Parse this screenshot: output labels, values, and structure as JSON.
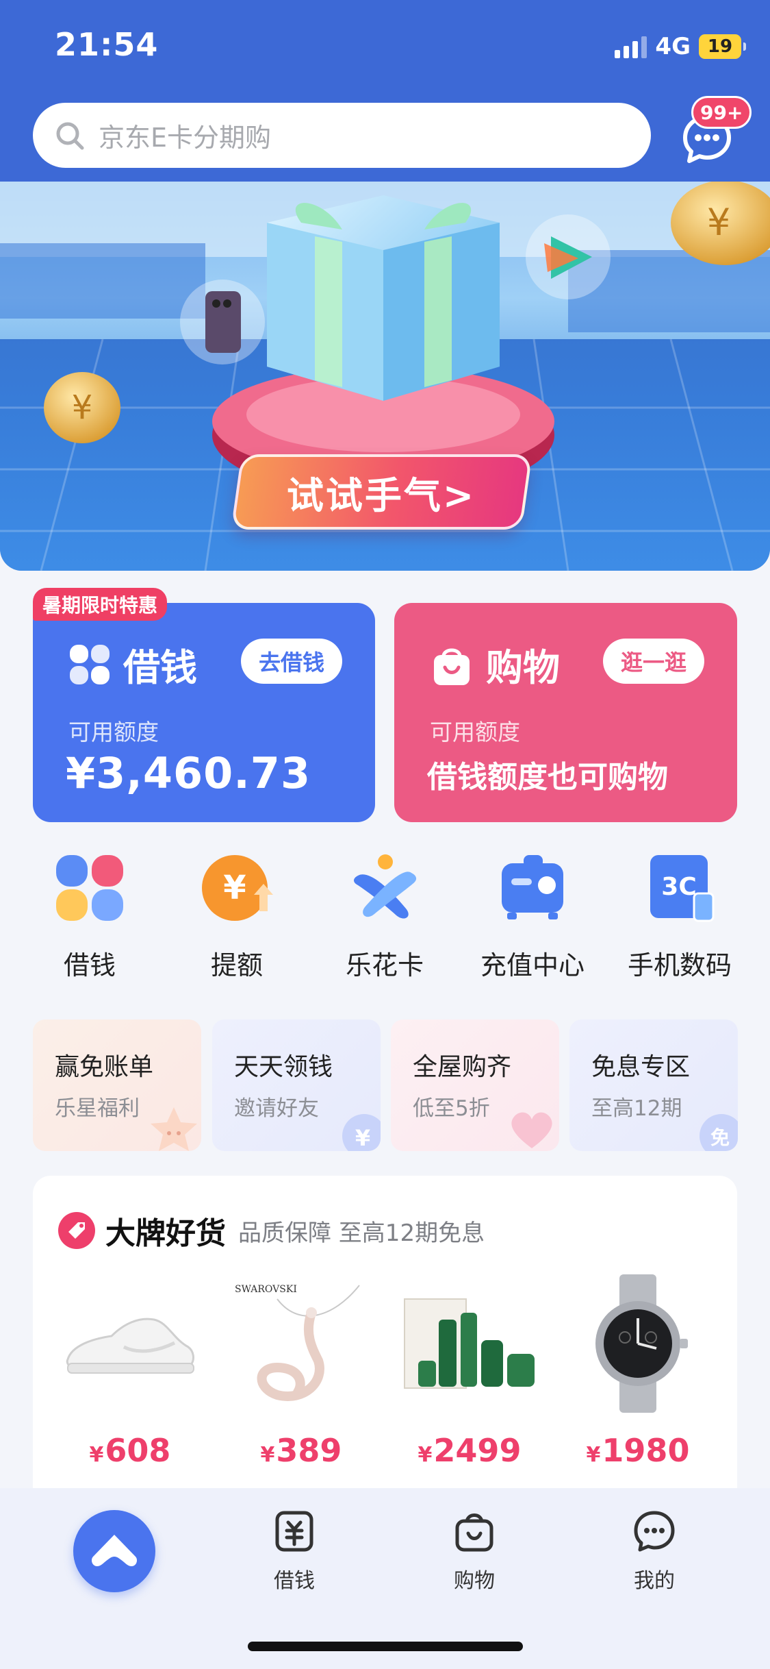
{
  "status_bar": {
    "time": "21:54",
    "network": "4G",
    "battery": "19"
  },
  "search": {
    "placeholder": "京东E卡分期购"
  },
  "messages": {
    "badge": "99+"
  },
  "banner": {
    "cta": "试试手气>"
  },
  "loan_card": {
    "promo_tag": "暑期限时特惠",
    "title": "借钱",
    "button": "去借钱",
    "sub": "可用额度",
    "amount": "¥3,460.73"
  },
  "shop_card": {
    "title": "购物",
    "button": "逛一逛",
    "sub": "可用额度",
    "desc": "借钱额度也可购物"
  },
  "quick_actions": [
    {
      "label": "借钱",
      "icon": "clover-icon"
    },
    {
      "label": "提额",
      "icon": "yuan-up-icon"
    },
    {
      "label": "乐花卡",
      "icon": "lehua-card-icon"
    },
    {
      "label": "充值中心",
      "icon": "recharge-icon"
    },
    {
      "label": "手机数码",
      "icon": "3c-digital-icon"
    }
  ],
  "promo_tiles": [
    {
      "title": "赢免账单",
      "sub": "乐星福利"
    },
    {
      "title": "天天领钱",
      "sub": "邀请好友"
    },
    {
      "title": "全屋购齐",
      "sub": "低至5折"
    },
    {
      "title": "免息专区",
      "sub": "至高12期"
    }
  ],
  "tile_badges": {
    "yuan": "¥",
    "free": "免"
  },
  "brand_section": {
    "title": "大牌好货",
    "sub": "品质保障 至高12期免息",
    "products": [
      {
        "name": "sneaker",
        "currency": "¥",
        "price": "608"
      },
      {
        "name": "swan-necklace",
        "currency": "¥",
        "price": "389",
        "logo": "SWAROVSKI"
      },
      {
        "name": "skincare-set",
        "currency": "¥",
        "price": "2499"
      },
      {
        "name": "watch",
        "currency": "¥",
        "price": "1980"
      }
    ]
  },
  "tabbar": {
    "items": [
      {
        "label": "借钱"
      },
      {
        "label": "购物"
      },
      {
        "label": "我的"
      }
    ]
  },
  "colors": {
    "header_blue": "#3d69d6",
    "loan_blue": "#4a74ee",
    "shop_pink": "#ec5a84",
    "price_pink": "#ee3f6b"
  }
}
